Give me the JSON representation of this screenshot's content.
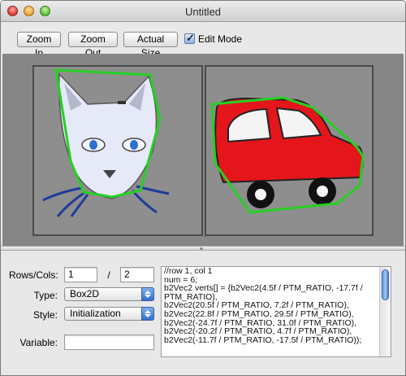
{
  "window": {
    "title": "Untitled"
  },
  "toolbar": {
    "zoom_in": "Zoom In",
    "zoom_out": "Zoom Out",
    "actual_size": "Actual Size",
    "edit_mode_label": "Edit Mode",
    "edit_mode_checked": true
  },
  "canvas": {
    "tiles": [
      {
        "name": "cat",
        "icon": "cat-face-sprite"
      },
      {
        "name": "car",
        "icon": "red-car-sprite"
      }
    ],
    "outline_color": "#25d022"
  },
  "form": {
    "rows_cols_label": "Rows/Cols:",
    "rows_value": "1",
    "separator": "/",
    "cols_value": "2",
    "type_label": "Type:",
    "type_value": "Box2D",
    "style_label": "Style:",
    "style_value": "Initialization",
    "variable_label": "Variable:",
    "variable_value": ""
  },
  "code": {
    "text": "//row 1, col 1\nnum = 6;\nb2Vec2 verts[] = {b2Vec2(4.5f / PTM_RATIO, -17.7f / PTM_RATIO),\nb2Vec2(20.5f / PTM_RATIO, 7.2f / PTM_RATIO),\nb2Vec2(22.8f / PTM_RATIO, 29.5f / PTM_RATIO),\nb2Vec2(-24.7f / PTM_RATIO, 31.0f / PTM_RATIO),\nb2Vec2(-20.2f / PTM_RATIO, 4.7f / PTM_RATIO),\nb2Vec2(-11.7f / PTM_RATIO, -17.5f / PTM_RATIO));"
  }
}
